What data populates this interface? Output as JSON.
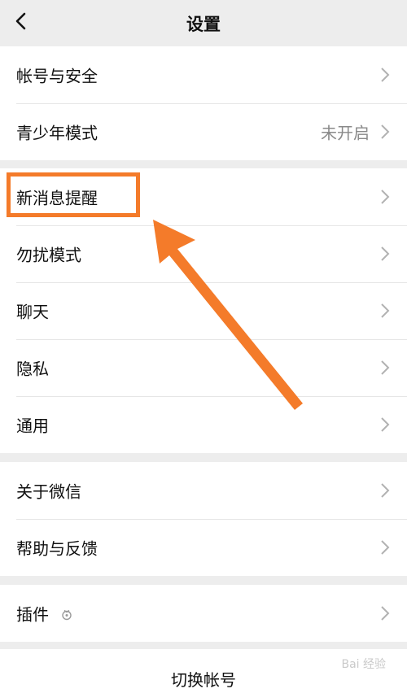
{
  "header": {
    "title": "设置",
    "back_icon": "back-chevron-icon"
  },
  "groups": [
    {
      "items": [
        {
          "label": "帐号与安全"
        },
        {
          "label": "青少年模式",
          "value": "未开启"
        }
      ]
    },
    {
      "items": [
        {
          "label": "新消息提醒"
        },
        {
          "label": "勿扰模式"
        },
        {
          "label": "聊天"
        },
        {
          "label": "隐私"
        },
        {
          "label": "通用"
        }
      ]
    },
    {
      "items": [
        {
          "label": "关于微信"
        },
        {
          "label": "帮助与反馈"
        }
      ]
    },
    {
      "items": [
        {
          "label": "插件",
          "icon": "plugin-icon"
        }
      ]
    }
  ],
  "footer": {
    "switch_account": "切换帐号"
  },
  "annotation": {
    "highlight_color": "#f47b2a",
    "arrow_icon": "orange-arrow-icon"
  },
  "watermark": {
    "text": "Bai 经验"
  }
}
